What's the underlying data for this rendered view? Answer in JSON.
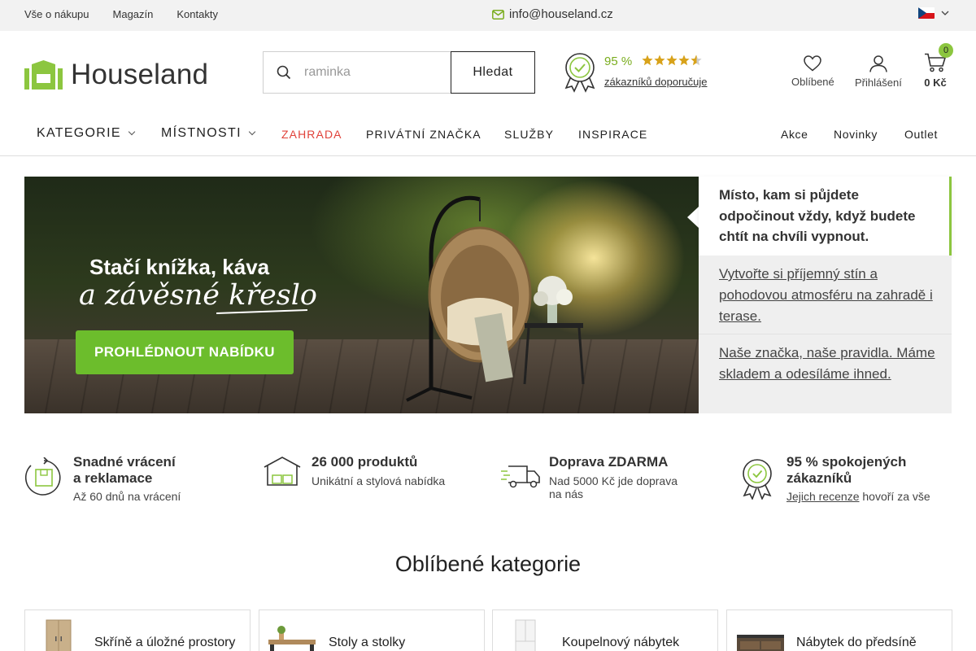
{
  "topbar": {
    "links": [
      "Vše o nákupu",
      "Magazín",
      "Kontakty"
    ],
    "email": "info@houseland.cz",
    "language": "CZ"
  },
  "header": {
    "logo": "Houseland",
    "search_placeholder": "raminka",
    "search_button": "Hledat",
    "rating_percent": "95 %",
    "rating_stars": 4.5,
    "rating_link": "zákazníků doporučuje",
    "favorites": "Oblíbené",
    "login": "Přihlášení",
    "cart_count": "0",
    "cart_total": "0 Kč"
  },
  "nav": {
    "kategorie": "KATEGORIE",
    "mistnosti": "MÍSTNOSTI",
    "zahrada": "ZAHRADA",
    "privatni": "PRIVÁTNÍ ZNAČKA",
    "sluzby": "SLUŽBY",
    "inspirace": "INSPIRACE",
    "akce": "Akce",
    "novinky": "Novinky",
    "outlet": "Outlet"
  },
  "banner": {
    "line1": "Stačí knížka, káva",
    "line2": "a závěsné křeslo",
    "cta": "PROHLÉDNOUT NABÍDKU"
  },
  "tabs": {
    "active": "Místo, kam si půjdete odpočinout vždy, když budete chtít na chvíli vypnout.",
    "second": "Vytvořte si příjemný stín a pohodovou atmosféru na zahradě i terase.",
    "third": "Naše značka, naše pravidla. Máme skladem a odesíláme ihned."
  },
  "features": [
    {
      "title1": "Snadné vrácení",
      "title2": "a reklamace",
      "sub": "Až 60 dnů na vrácení"
    },
    {
      "title1": "26 000 produktů",
      "sub": "Unikátní a stylová nabídka"
    },
    {
      "title1": "Doprava ZDARMA",
      "sub1": "Nad 5000 Kč jde doprava",
      "sub2": "na nás"
    },
    {
      "title1": "95 % spokojených",
      "title2": "zákazníků",
      "link": "Jejich recenze",
      "sub_rest": " hovoří za vše"
    }
  ],
  "categories_title": "Oblíbené kategorie",
  "categories": [
    "Skříně a úložné prostory",
    "Stoly a stolky",
    "Koupelnový nábytek",
    "Nábytek do předsíně"
  ],
  "colors": {
    "accent": "#8cc63f",
    "sale_red": "#e0423a",
    "cta_green": "#6cbd2c"
  }
}
